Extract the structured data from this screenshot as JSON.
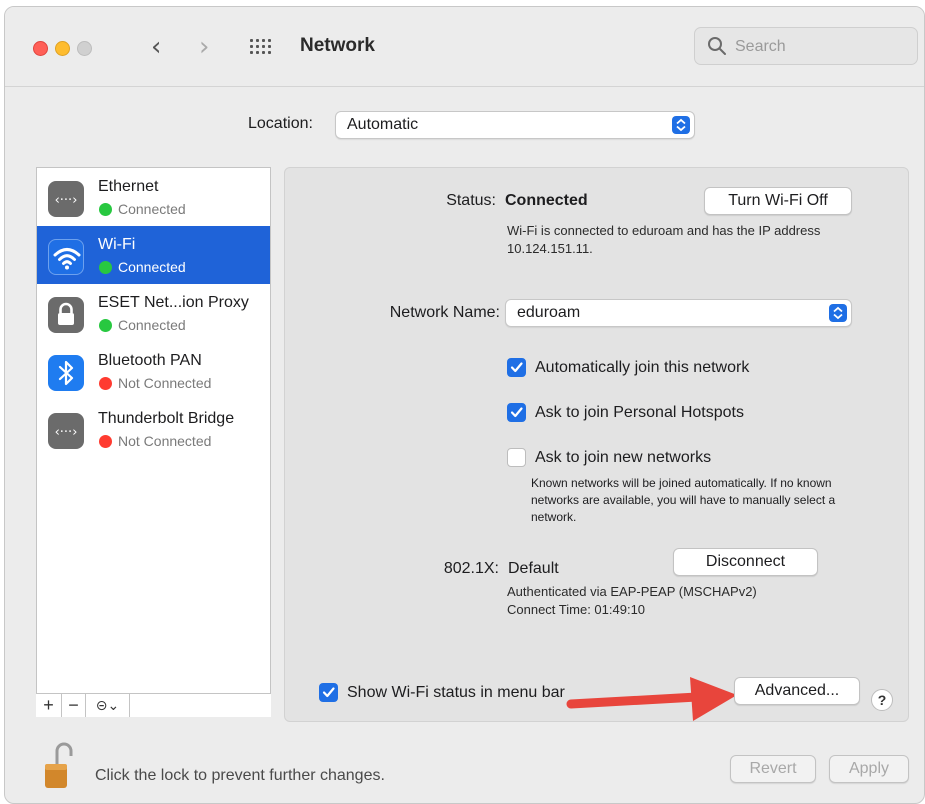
{
  "window": {
    "title": "Network",
    "search_placeholder": "Search"
  },
  "location": {
    "label": "Location:",
    "value": "Automatic"
  },
  "services": [
    {
      "name": "Ethernet",
      "status": "Connected",
      "status_color": "#28c840",
      "icon": "ethernet-icon"
    },
    {
      "name": "Wi-Fi",
      "status": "Connected",
      "status_color": "#28c840",
      "icon": "wifi-icon",
      "selected": true
    },
    {
      "name": "ESET Net...ion Proxy",
      "status": "Connected",
      "status_color": "#28c840",
      "icon": "lock-icon"
    },
    {
      "name": "Bluetooth PAN",
      "status": "Not Connected",
      "status_color": "#ff3b30",
      "icon": "bluetooth-icon"
    },
    {
      "name": "Thunderbolt Bridge",
      "status": "Not Connected",
      "status_color": "#ff3b30",
      "icon": "ethernet-icon"
    }
  ],
  "sidebar_tools": {
    "add": "+",
    "remove": "−",
    "more": "⊝⌄"
  },
  "detail": {
    "status_label": "Status:",
    "status_value": "Connected",
    "turn_off_button": "Turn Wi-Fi Off",
    "status_description": "Wi-Fi is connected to eduroam and has the IP address 10.124.151.11.",
    "network_name_label": "Network Name:",
    "network_name_value": "eduroam",
    "checkboxes": [
      {
        "label": "Automatically join this network",
        "checked": true
      },
      {
        "label": "Ask to join Personal Hotspots",
        "checked": true
      },
      {
        "label": "Ask to join new networks",
        "checked": false
      }
    ],
    "join_note": "Known networks will be joined automatically. If no known networks are available, you will have to manually select a network.",
    "dot1x_label": "802.1X:",
    "dot1x_value": "Default",
    "disconnect_button": "Disconnect",
    "auth_line1": "Authenticated via EAP-PEAP (MSCHAPv2)",
    "auth_line2": "Connect Time: 01:49:10",
    "show_status_label": "Show Wi-Fi status in menu bar",
    "show_status_checked": true,
    "advanced_button": "Advanced...",
    "help_button": "?"
  },
  "footer": {
    "lock_text": "Click the lock to prevent further changes.",
    "revert_button": "Revert",
    "apply_button": "Apply"
  },
  "colors": {
    "accent": "#1f6fe5",
    "selection": "#1f63d8",
    "arrow": "#e8453c"
  }
}
